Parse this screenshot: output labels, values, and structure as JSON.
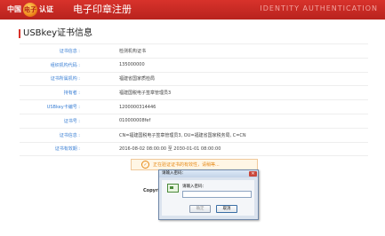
{
  "header": {
    "logo_left": "中国",
    "logo_circle": "电子",
    "logo_right": "认证",
    "title": "电子印章注册",
    "right_text": "IDENTITY AUTHENTICATION"
  },
  "section": {
    "title": "USBkey证书信息"
  },
  "info_rows": [
    {
      "label": "证书信息",
      "value": "检测机构证书"
    },
    {
      "label": "组织机构代码",
      "value": "135000000"
    },
    {
      "label": "证书所属机构",
      "value": "福建省国家质检局"
    },
    {
      "label": "持有者",
      "value": "福建国税电子签章管理员3"
    },
    {
      "label": "USBkey卡编号",
      "value": "1200000314446"
    },
    {
      "label": "证书号",
      "value": "010000008fef"
    },
    {
      "label": "证书信息",
      "value": "CN=福建国税电子签章管理员3, OU=福建省国家税务局, C=CN"
    },
    {
      "label": "证书有效期",
      "value": "2016-08-02 08:00:00 至 2030-01-01 08:00:00"
    }
  ],
  "alert": {
    "icon": "✓",
    "text": "正在验证证书的有效性，请稍等..."
  },
  "footer": {
    "copyright": "Copyright"
  },
  "dialog": {
    "title": "请输入密码：",
    "close": "✕",
    "label": "请输入密码：",
    "password": "",
    "confirm": "确定",
    "cancel": "取消"
  }
}
